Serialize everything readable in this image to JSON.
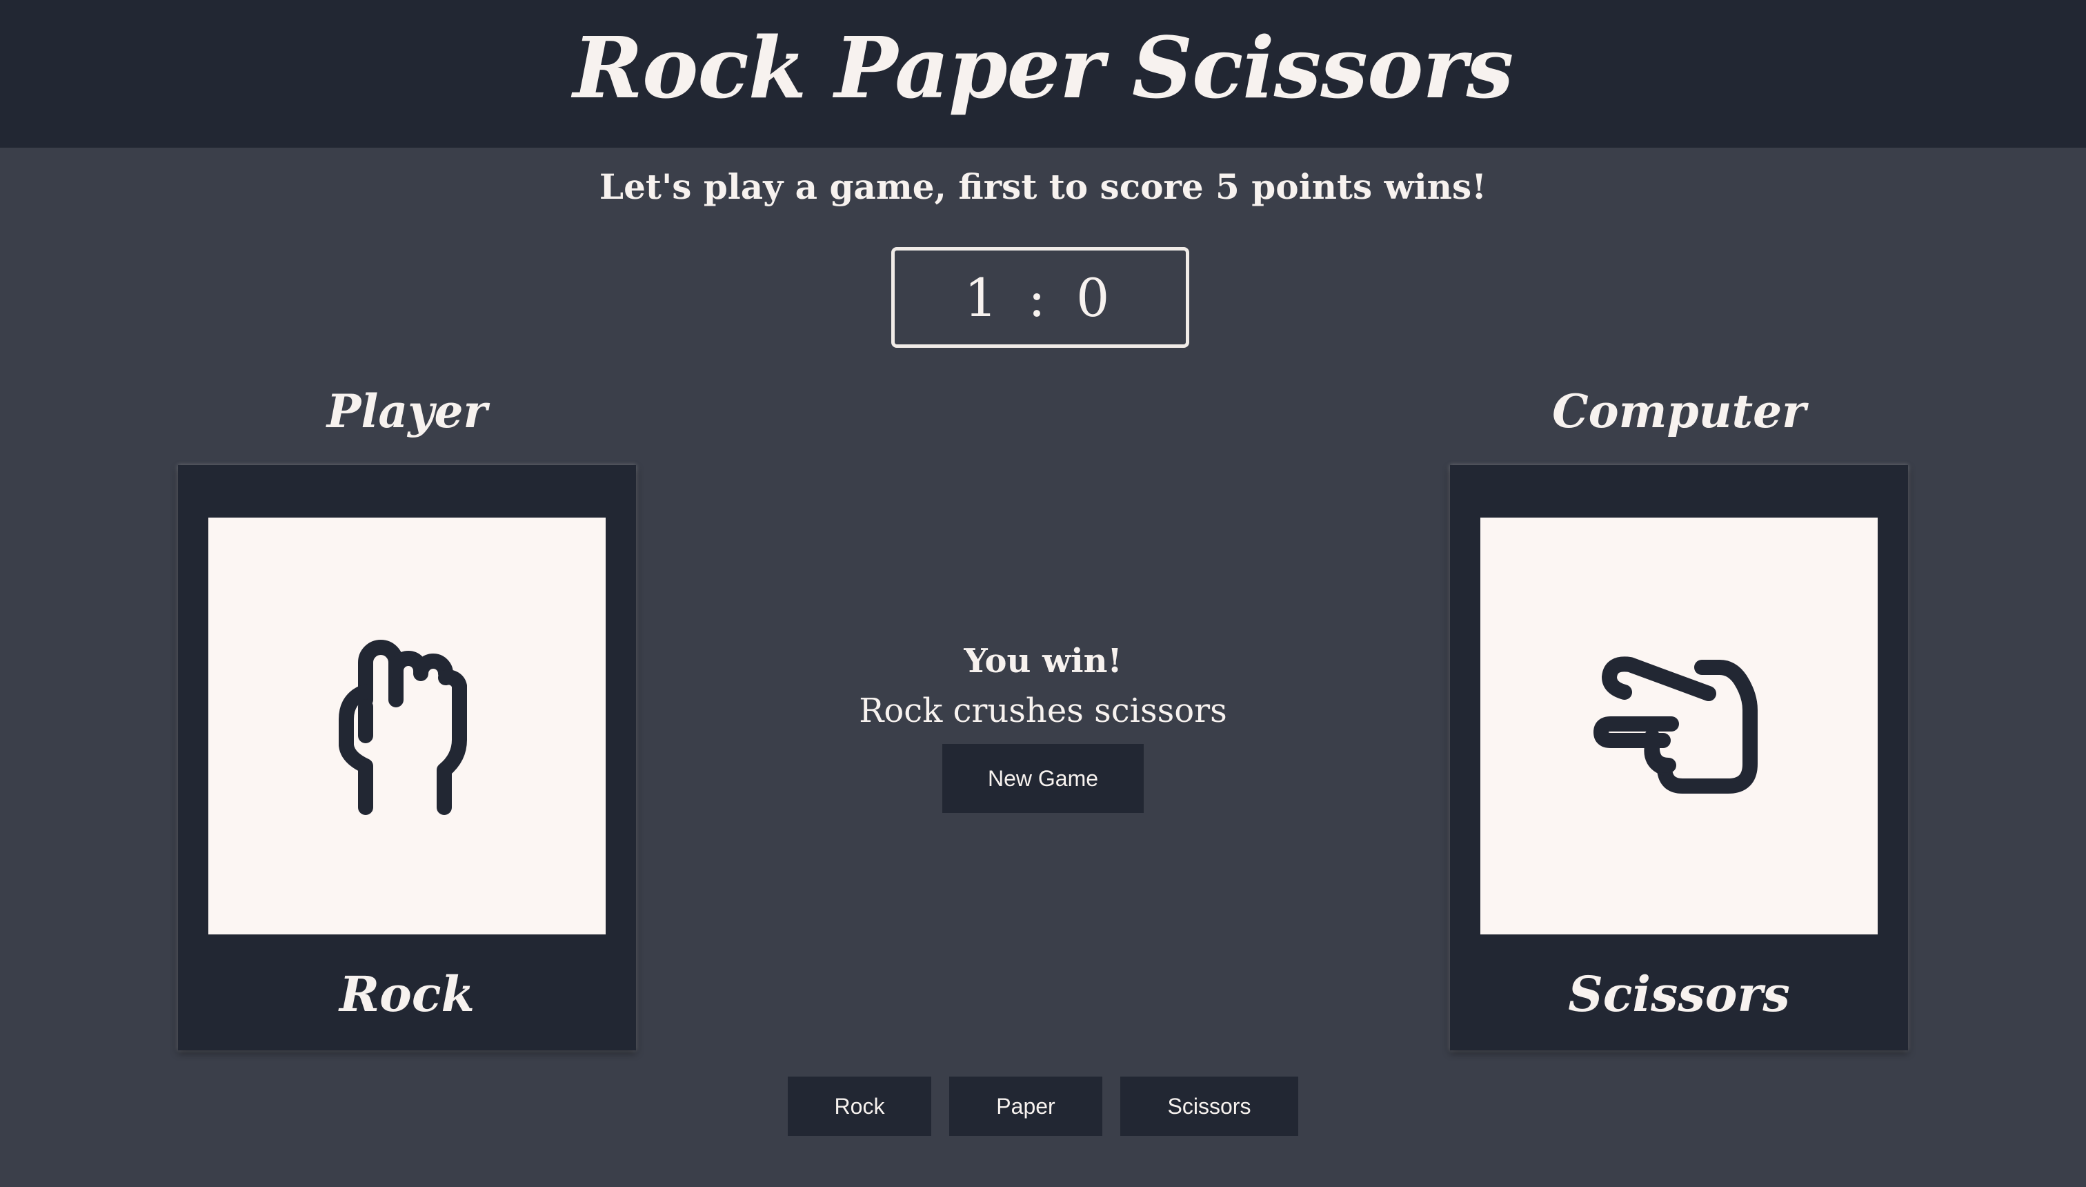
{
  "header": {
    "title": "Rock Paper Scissors"
  },
  "intro": {
    "text": "Let's play a game, first to score 5 points wins!"
  },
  "score": {
    "display": "1 : 0",
    "player": 1,
    "computer": 0
  },
  "player": {
    "label": "Player",
    "choice": "Rock",
    "icon": "fist-icon"
  },
  "computer": {
    "label": "Computer",
    "choice": "Scissors",
    "icon": "scissors-hand-icon"
  },
  "result": {
    "headline": "You win!",
    "detail": "Rock crushes scissors",
    "new_game_label": "New Game"
  },
  "choices": {
    "rock_label": "Rock",
    "paper_label": "Paper",
    "scissors_label": "Scissors"
  },
  "colors": {
    "background": "#3b3f4a",
    "dark_panel": "#222733",
    "card_face": "#fcf6f3",
    "text": "#f7f2ef"
  }
}
